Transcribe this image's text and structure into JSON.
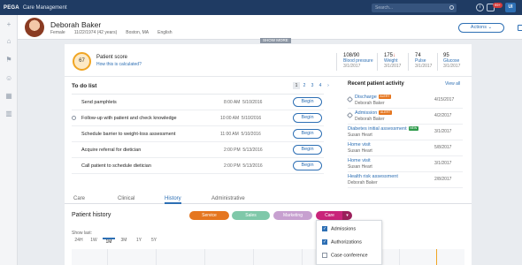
{
  "topbar": {
    "brand": "PEGA",
    "app_name": "Care Management",
    "search_placeholder": "Search...",
    "notification_count": "99+",
    "user_initials": "UI"
  },
  "patient": {
    "name": "Deborah Baker",
    "gender": "Female",
    "dob": "11/22/1974 (42 years)",
    "location": "Boston, MA",
    "language": "English",
    "actions_label": "Actions",
    "show_more": "SHOW MORE"
  },
  "score": {
    "value": "67",
    "title": "Patient score",
    "link": "How this is calculated?"
  },
  "vitals": [
    {
      "value": "108/90",
      "arrow": "",
      "label": "Blood pressure",
      "date": "3/1/2017"
    },
    {
      "value": "175",
      "arrow": "↓",
      "label": "Weight",
      "date": "3/1/2017"
    },
    {
      "value": "74",
      "arrow": "",
      "label": "Pulse",
      "date": "3/1/2017"
    },
    {
      "value": "95",
      "arrow": "",
      "label": "Glucose",
      "date": "3/1/2017"
    }
  ],
  "todo": {
    "title": "To do list",
    "pages": [
      "1",
      "2",
      "3",
      "4"
    ],
    "begin_label": "Begin",
    "items": [
      {
        "text": "Send pamphlets",
        "time": "8:00 AM",
        "date": "5/10/2016"
      },
      {
        "text": "Follow-up with patient and check knowledge",
        "time": "10:00 AM",
        "date": "5/10/2016"
      },
      {
        "text": "Schedule barrier to weight-loss assessment",
        "time": "11:00 AM",
        "date": "5/10/2016"
      },
      {
        "text": "Acquire referral for dietician",
        "time": "2:00 PM",
        "date": "5/13/2016"
      },
      {
        "text": "Call patient to schedule dietician",
        "time": "2:00 PM",
        "date": "5/13/2016"
      }
    ]
  },
  "recent": {
    "title": "Recent patient activity",
    "view_all": "View all",
    "items": [
      {
        "title": "Discharge",
        "badge": "ALERT",
        "badge_color": "#e5761f",
        "sub": "Deborah Baker",
        "date": "4/15/2017"
      },
      {
        "title": "Admission",
        "badge": "ALERT",
        "badge_color": "#e5761f",
        "sub": "Deborah Baker",
        "date": "4/2/2017"
      },
      {
        "title": "Diabetes initial assessment",
        "badge": "NEW",
        "badge_color": "#2e9a4a",
        "sub": "Susan Heart",
        "date": "3/1/2017"
      },
      {
        "title": "Home visit",
        "badge": "",
        "badge_color": "",
        "sub": "Susan Heart",
        "date": "5/8/2017"
      },
      {
        "title": "Home visit",
        "badge": "",
        "badge_color": "",
        "sub": "Susan Heart",
        "date": "3/1/2017"
      },
      {
        "title": "Health risk assessment",
        "badge": "",
        "badge_color": "",
        "sub": "Deborah Baker",
        "date": "2/8/2017"
      }
    ]
  },
  "tabs": [
    "Care",
    "Clinical",
    "History",
    "Administrative"
  ],
  "history": {
    "title": "Patient history",
    "pills": [
      {
        "label": "Service",
        "color": "#e5761f"
      },
      {
        "label": "Sales",
        "color": "#7fc8a9"
      },
      {
        "label": "Marketing",
        "color": "#c7a0d0"
      },
      {
        "label": "Care",
        "color": "#c9247a"
      }
    ],
    "show_last": "Show last:",
    "ranges": [
      "24H",
      "1W",
      "1M",
      "3M",
      "1Y",
      "5Y"
    ],
    "active_range": "1M"
  },
  "dropdown": [
    {
      "label": "Admissions",
      "checked": true
    },
    {
      "label": "Authorizations",
      "checked": true
    },
    {
      "label": "Case conference",
      "checked": false
    }
  ],
  "colors": {
    "header": "#1f3b63",
    "accent": "#2d6fb4",
    "score_ring": "#f0a523"
  }
}
